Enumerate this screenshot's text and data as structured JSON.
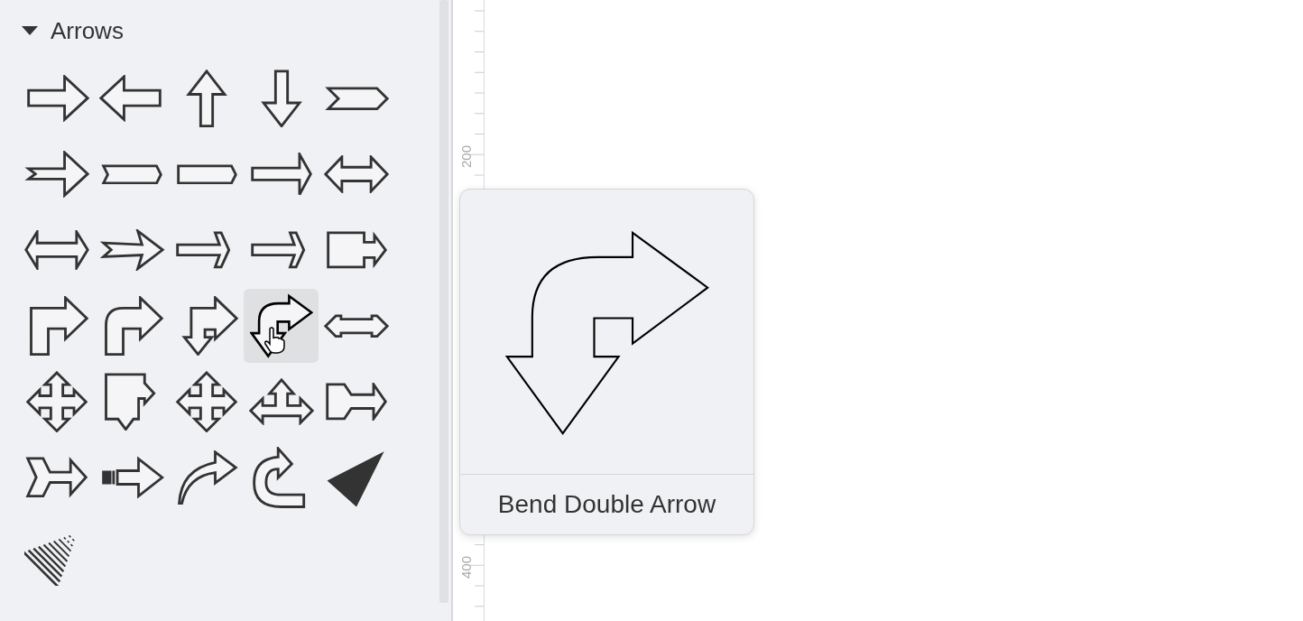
{
  "sidebar": {
    "section": {
      "title": "Arrows",
      "expanded": true,
      "shapes": [
        {
          "kind": "right",
          "selected": false
        },
        {
          "kind": "left",
          "selected": false
        },
        {
          "kind": "up",
          "selected": false
        },
        {
          "kind": "down",
          "selected": false
        },
        {
          "kind": "chevron",
          "selected": false
        },
        {
          "kind": "notched",
          "selected": false
        },
        {
          "kind": "chevronbar",
          "selected": false
        },
        {
          "kind": "pentagon",
          "selected": false
        },
        {
          "kind": "thin",
          "selected": false
        },
        {
          "kind": "double",
          "selected": false
        },
        {
          "kind": "leftright",
          "selected": false
        },
        {
          "kind": "swallow",
          "selected": false
        },
        {
          "kind": "open",
          "selected": false
        },
        {
          "kind": "open",
          "selected": false
        },
        {
          "kind": "callout",
          "selected": false
        },
        {
          "kind": "bent",
          "selected": false
        },
        {
          "kind": "bentround",
          "selected": false
        },
        {
          "kind": "bentup",
          "selected": false
        },
        {
          "kind": "benddouble",
          "selected": true
        },
        {
          "kind": "doublebox",
          "selected": false
        },
        {
          "kind": "quad",
          "selected": false
        },
        {
          "kind": "boxarrows",
          "selected": false
        },
        {
          "kind": "quad",
          "selected": false
        },
        {
          "kind": "triple",
          "selected": false
        },
        {
          "kind": "connector",
          "selected": false
        },
        {
          "kind": "tail",
          "selected": false
        },
        {
          "kind": "striped",
          "selected": false
        },
        {
          "kind": "curved",
          "selected": false
        },
        {
          "kind": "uturn",
          "selected": false
        },
        {
          "kind": "triangle",
          "selected": false
        },
        {
          "kind": "cone",
          "selected": false
        }
      ]
    }
  },
  "ruler": {
    "labels": [
      "200",
      "400"
    ]
  },
  "tooltip": {
    "title": "Bend Double Arrow"
  }
}
